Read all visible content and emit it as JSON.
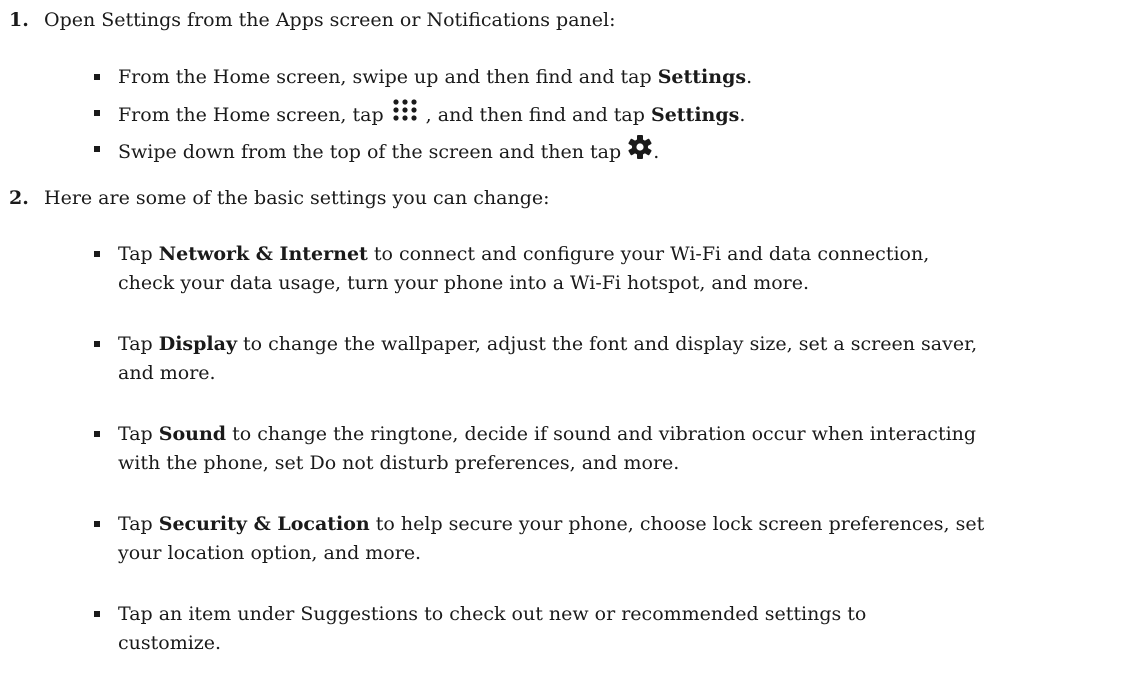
{
  "steps": [
    {
      "number": "1.",
      "text": "Open Settings from the Apps screen or Notifications panel:",
      "bullets": [
        {
          "before": "From the Home screen, swipe up and then find and tap ",
          "bold": "Settings",
          "after": "."
        },
        {
          "before": "From the Home screen, tap ",
          "icon": "apps-grid-icon",
          "middle": ", and then find and tap ",
          "bold": "Settings",
          "after": "."
        },
        {
          "before": "Swipe down from the top of the screen and then tap ",
          "icon": "gear-icon",
          "after": "."
        }
      ]
    },
    {
      "number": "2.",
      "text": "Here are some of the basic settings you can change:",
      "bullets": [
        {
          "before": "Tap ",
          "bold": "Network & Internet",
          "line1": " to connect and configure your Wi-Fi and data connection,",
          "line2": "check your data usage, turn your phone into a Wi-Fi hotspot, and more."
        },
        {
          "before": "Tap ",
          "bold": "Display",
          "line1": " to change the wallpaper, adjust the font and display size, set a screen saver,",
          "line2": "and more."
        },
        {
          "before": "Tap ",
          "bold": "Sound",
          "line1": " to change the ringtone, decide if sound and vibration occur when interacting",
          "line2": "with the phone, set Do not disturb preferences, and more."
        },
        {
          "before": "Tap ",
          "bold": "Security & Location",
          "line1": " to help secure your phone, choose lock screen preferences, set",
          "line2": "your location option, and more."
        },
        {
          "line1": "Tap an item under Suggestions to check out new or recommended settings to",
          "line2": "customize."
        }
      ]
    }
  ]
}
